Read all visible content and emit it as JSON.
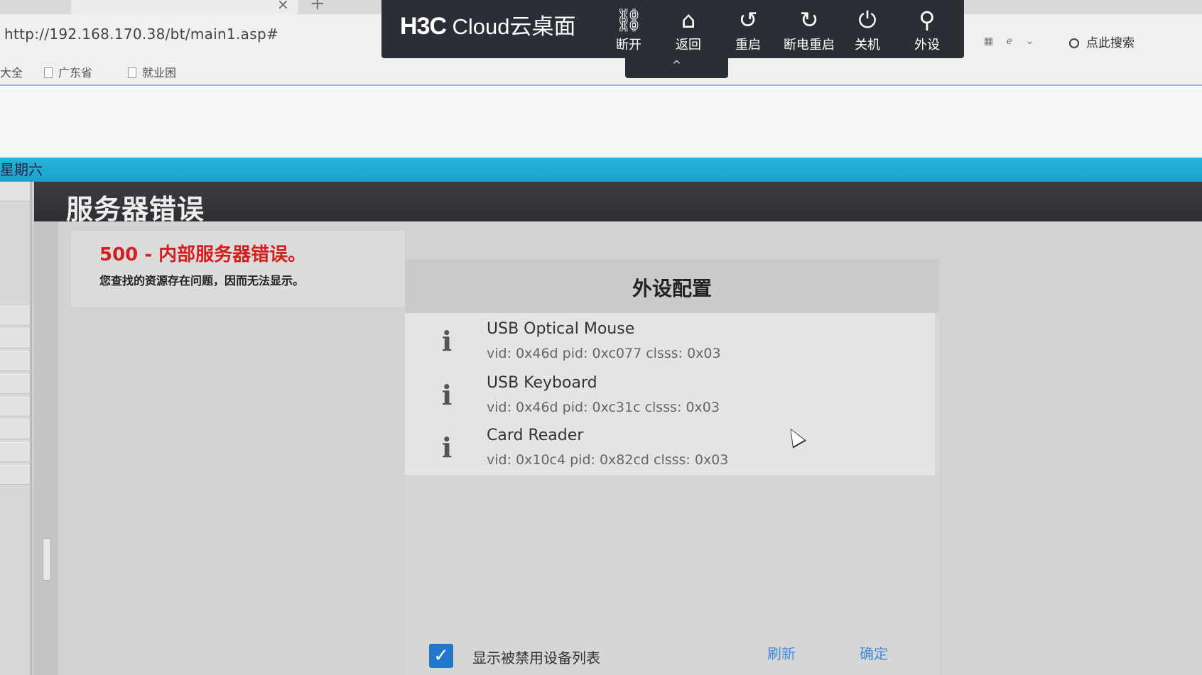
{
  "browser": {
    "url": "http://192.168.170.38/bt/main1.asp#",
    "tab_close": "×",
    "tab_new": "+",
    "bookmarks": [
      {
        "label": "大全"
      },
      {
        "label": "广东省",
        "icon": "document-icon"
      },
      {
        "label": "就业困",
        "icon": "document-icon"
      }
    ],
    "search_label": "点此搜索"
  },
  "vdi_toolbar": {
    "brand_main": "H3C",
    "brand_sub": "Cloud云桌面",
    "buttons": [
      {
        "label": "断开",
        "icon": "disconnect-icon",
        "glyph": "⛓"
      },
      {
        "label": "返回",
        "icon": "home-icon",
        "glyph": "⌂"
      },
      {
        "label": "重启",
        "icon": "restart-icon",
        "glyph": "↺"
      },
      {
        "label": "断电重启",
        "icon": "power-cycle-icon",
        "glyph": "↻"
      },
      {
        "label": "关机",
        "icon": "power-icon",
        "glyph": "⏻"
      },
      {
        "label": "外设",
        "icon": "usb-icon",
        "glyph": "⚲"
      }
    ],
    "handle_glyph": "^"
  },
  "page": {
    "weekday": "星期六",
    "error_header": "服务器错误",
    "error_code": "500 - 内部服务器错误。",
    "error_desc": "您查找的资源存在问题，因而无法显示。"
  },
  "dialog": {
    "title": "外设配置",
    "devices": [
      {
        "name": "USB Optical Mouse",
        "meta": "vid: 0x46d  pid: 0xc077  clsss: 0x03"
      },
      {
        "name": "USB Keyboard",
        "meta": "vid: 0x46d  pid: 0xc31c  clsss: 0x03"
      },
      {
        "name": "Card Reader",
        "meta": "vid: 0x10c4  pid: 0x82cd  clsss: 0x03"
      }
    ],
    "show_disabled_label": "显示被禁用设备列表",
    "show_disabled_checked": true,
    "refresh_label": "刷新",
    "confirm_label": "确定"
  },
  "colors": {
    "toolbar_bg": "#2b2f35",
    "accent_strip": "#1aa4cc",
    "error_red": "#d21f1f",
    "link_blue": "#3f8fe0",
    "checkbox_blue": "#2377c9"
  }
}
